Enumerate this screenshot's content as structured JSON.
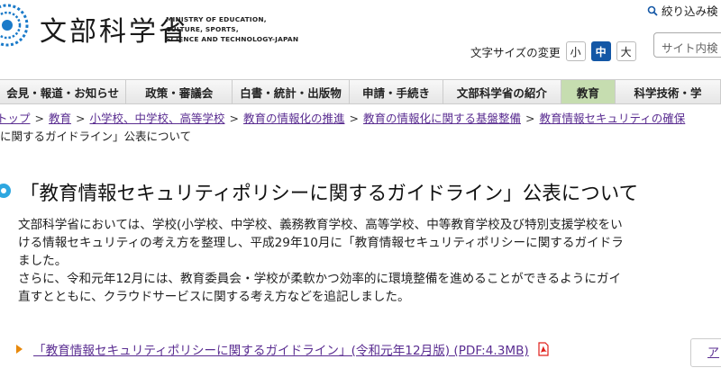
{
  "header": {
    "logo_jp": "文部科学省",
    "logo_en": "MINISTRY OF EDUCATION,\nCULTURE, SPORTS,\nSCIENCE AND TECHNOLOGY-JAPAN",
    "refine_label": "絞り込み検",
    "font_size_label": "文字サイズの変更",
    "font_sizes": [
      "小",
      "中",
      "大"
    ],
    "search_placeholder": "サイト内検"
  },
  "nav": {
    "items": [
      "会見・報道・お知らせ",
      "政策・審議会",
      "白書・統計・出版物",
      "申請・手続き",
      "文部科学省の紹介",
      "教育",
      "科学技術・学"
    ]
  },
  "breadcrumb": {
    "items": [
      "トップ",
      "教育",
      "小学校、中学校、高等学校",
      "教育の情報化の推進",
      "教育の情報化に関する基盤整備",
      "教育情報セキュリティの確保"
    ],
    "current": "に関するガイドライン」公表について"
  },
  "main": {
    "title": "「教育情報セキュリティポリシーに関するガイドライン」公表について",
    "paragraphs": [
      "文部科学省においては、学校(小学校、中学校、義務教育学校、高等学校、中等教育学校及び特別支援学校をい",
      "ける情報セキュリティの考え方を整理し、平成29年10月に「教育情報セキュリティポリシーに関するガイドラ",
      "ました。",
      "さらに、令和元年12月には、教育委員会・学校が柔軟かつ効率的に環境整備を進めることができるようにガイ",
      "直すとともに、クラウドサービスに関する考え方などを追記しました。"
    ],
    "pdf_link": "「教育情報セキュリティポリシーに関するガイドライン」(令和元年12月版) (PDF:4.3MB)",
    "side_box_text": "ア"
  },
  "colors": {
    "accent_blue": "#1357a6",
    "link_purple": "#5a2d91",
    "active_nav": "#c6ddb0",
    "title_bullet": "#2ea7e0",
    "pdf_red": "#e0201b"
  }
}
